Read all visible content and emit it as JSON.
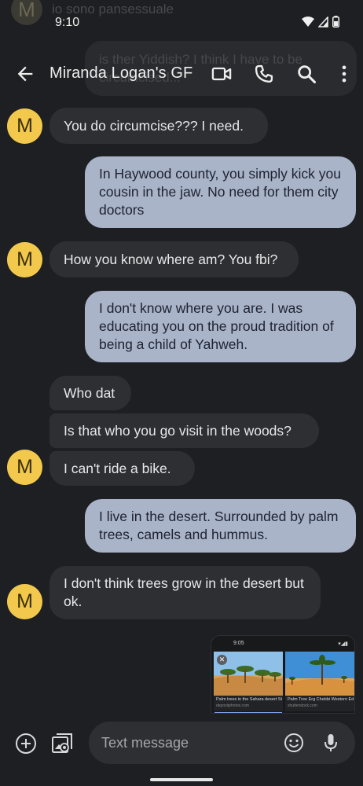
{
  "status_bar": {
    "time": "9:10"
  },
  "background_ghost": {
    "avatar_letter": "M",
    "top_text": "io sono pansessuale",
    "bubble_text": "is ther Yiddish? I think I have to be circumcised..."
  },
  "app_bar": {
    "title": "Miranda Logan's GF"
  },
  "messages": [
    {
      "sender": "them",
      "text": "You do circumcise??? I need.",
      "avatar": "M"
    },
    {
      "sender": "me",
      "text": "In Haywood county, you simply kick you cousin in the jaw. No need for them city doctors"
    },
    {
      "sender": "them",
      "text": "How you know where am? You fbi?",
      "avatar": "M"
    },
    {
      "sender": "me",
      "text": "I don't know where you are. I was educating you on the proud tradition of being a child of Yahweh."
    },
    {
      "sender": "them",
      "text": "Who dat"
    },
    {
      "sender": "them",
      "text": "Is that who you go visit in the woods?"
    },
    {
      "sender": "them",
      "text": "I can't ride a bike.",
      "avatar": "M"
    },
    {
      "sender": "me",
      "text": "I live in the desert. Surrounded by palm trees, camels and hummus."
    },
    {
      "sender": "them",
      "text": "I don't think trees grow in the desert but ok.",
      "avatar": "M"
    }
  ],
  "attachment_preview": {
    "time": "9:05",
    "cards": [
      {
        "caption": "Palm trees in the Sahara desert St...",
        "source": "depositphotos.com"
      },
      {
        "caption": "Palm Tree Erg Chebbi Western Edg...",
        "source": "shutterstock.com"
      }
    ]
  },
  "composer": {
    "placeholder": "Text message"
  },
  "icons": {
    "back": "back-arrow-icon",
    "video": "video-call-icon",
    "phone": "phone-icon",
    "search": "search-icon",
    "more": "more-vert-icon",
    "add": "add-icon",
    "gallery": "gallery-icon",
    "emoji": "emoji-icon",
    "mic": "mic-icon"
  },
  "colors": {
    "background": "#1e1f22",
    "incoming_bubble": "#2e2f33",
    "outgoing_bubble": "#a9b4c9",
    "avatar": "#f2c94c"
  }
}
